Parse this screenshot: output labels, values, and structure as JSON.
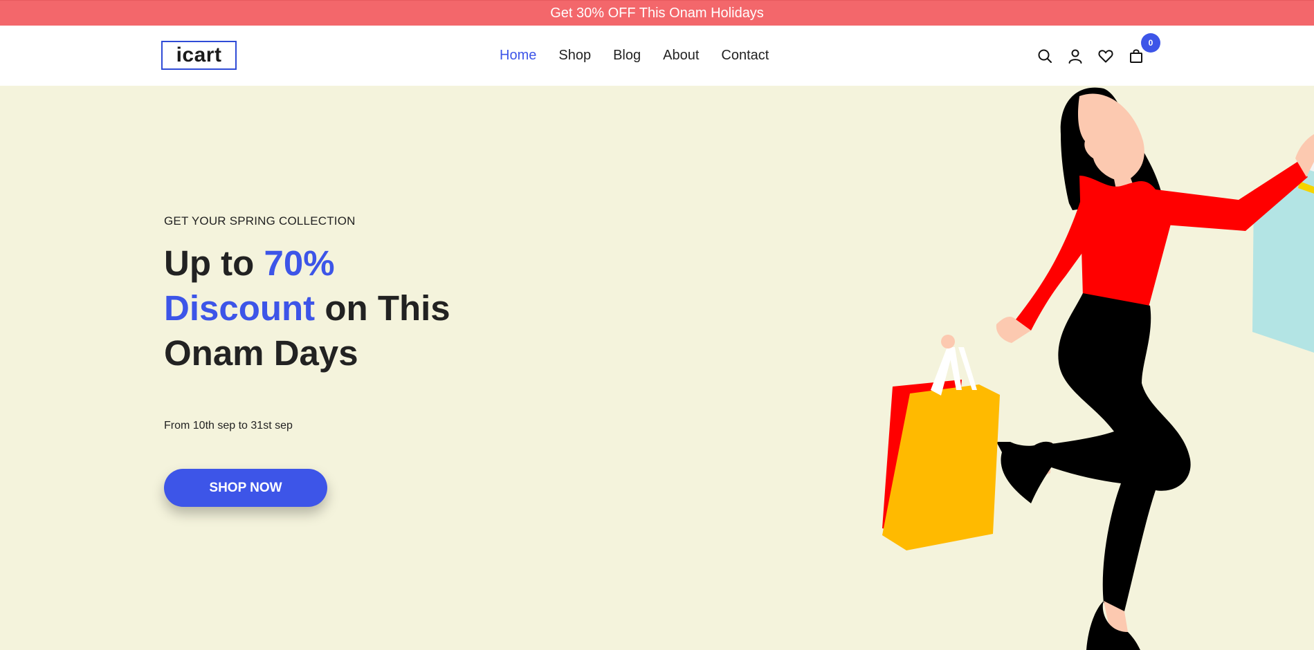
{
  "promo": {
    "text": "Get 30% OFF This Onam Holidays"
  },
  "header": {
    "logo": "icart",
    "nav": [
      {
        "label": "Home",
        "active": true
      },
      {
        "label": "Shop"
      },
      {
        "label": "Blog"
      },
      {
        "label": "About"
      },
      {
        "label": "Contact"
      }
    ],
    "icons": [
      "search-icon",
      "user-icon",
      "heart-icon",
      "shopping-bag-icon"
    ],
    "cart_count": "0"
  },
  "hero": {
    "subtitle": "GET YOUR SPRING COLLECTION",
    "headline": {
      "part1": "Up to ",
      "accent1": "70%",
      "accent2": "Discount",
      "part2": " on This Onam Days"
    },
    "dates": "From 10th sep to 31st sep",
    "cta": "SHOP NOW"
  },
  "colors": {
    "promo_bg": "#f3676b",
    "accent": "#3d55e8",
    "hero_bg": "#f4f3dc"
  }
}
